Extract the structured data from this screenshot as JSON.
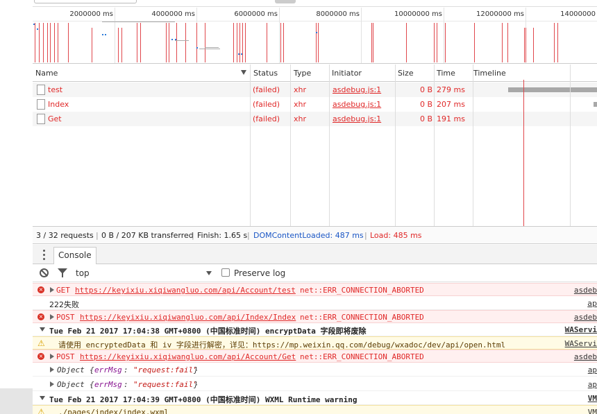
{
  "overview": {
    "ticks": [
      "2000000 ms",
      "4000000 ms",
      "6000000 ms",
      "8000000 ms",
      "10000000 ms",
      "12000000 ms",
      "14000000"
    ]
  },
  "table": {
    "columns": [
      "Name",
      "Status",
      "Type",
      "Initiator",
      "Size",
      "Time",
      "Timeline"
    ],
    "rows": [
      {
        "name": "test",
        "status": "(failed)",
        "type": "xhr",
        "initiator": "asdebug.js:1",
        "size": "0 B",
        "time": "279 ms"
      },
      {
        "name": "Index",
        "status": "(failed)",
        "type": "xhr",
        "initiator": "asdebug.js:1",
        "size": "0 B",
        "time": "207 ms"
      },
      {
        "name": "Get",
        "status": "(failed)",
        "type": "xhr",
        "initiator": "asdebug.js:1",
        "size": "0 B",
        "time": "191 ms"
      }
    ]
  },
  "summary": {
    "requests": "3 / 32 requests",
    "transferred": "0 B / 207 KB transferred",
    "finish": "Finish: 1.65 s",
    "dom": "DOMContentLoaded: 487 ms",
    "load": "Load: 485 ms",
    "sep": "|"
  },
  "console": {
    "tab": "Console",
    "context": "top",
    "preserve_log": "Preserve log",
    "messages": [
      {
        "kind": "error",
        "method": "GET",
        "url": "https://keyixiu.xiqiwangluo.com/api/Account/test",
        "err": "net::ERR_CONNECTION_ABORTED",
        "src": "asdeb"
      },
      {
        "kind": "log",
        "text": "222失败",
        "src": "ap"
      },
      {
        "kind": "error",
        "method": "POST",
        "url": "https://keyixiu.xiqiwangluo.com/api/Index/Index",
        "err": "net::ERR_CONNECTION_ABORTED",
        "src": "asdeb"
      },
      {
        "kind": "group",
        "text": "Tue Feb 21 2017 17:04:38 GMT+0800 (中国标准时间) encryptData 字段即将废除",
        "src": "WAServi"
      },
      {
        "kind": "warn",
        "text": "请使用 encryptedData 和 iv 字段进行解密，详见：https://mp.weixin.qq.com/debug/wxadoc/dev/api/open.html",
        "src": "WAServi"
      },
      {
        "kind": "error",
        "method": "POST",
        "url": "https://keyixiu.xiqiwangluo.com/api/Account/Get",
        "err": "net::ERR_CONNECTION_ABORTED",
        "src": "asdeb"
      },
      {
        "kind": "object",
        "obj": "Object",
        "key": "errMsg",
        "val": "\"request:fail\"",
        "src": "ap"
      },
      {
        "kind": "object",
        "obj": "Object",
        "key": "errMsg",
        "val": "\"request:fail\"",
        "src": "ap"
      },
      {
        "kind": "group",
        "text": "Tue Feb 21 2017 17:04:39 GMT+0800 (中国标准时间) WXML Runtime warning",
        "src": "VM"
      },
      {
        "kind": "warn",
        "text": "./pages/index/index.wxml",
        "src": "VM"
      }
    ]
  },
  "colors": {
    "error": "#e02828",
    "link": "#1a56c5",
    "warn": "#d9a100"
  }
}
